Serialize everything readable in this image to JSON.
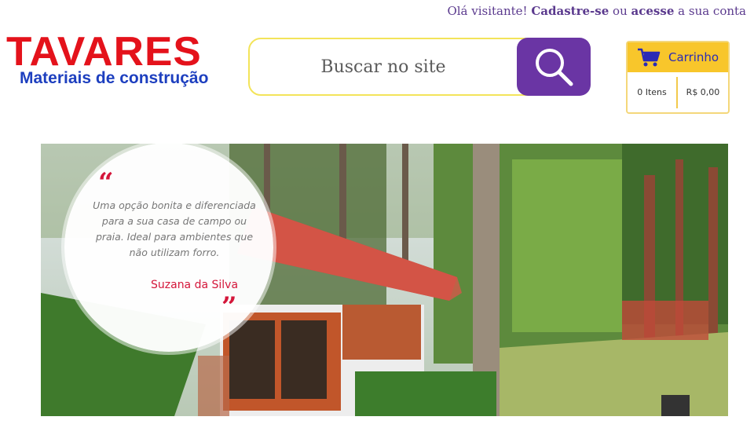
{
  "header": {
    "greeting": "Olá visitante!",
    "signup_link": "Cadastre-se",
    "or_text": "ou",
    "login_link": "acesse",
    "account_text": "a sua conta"
  },
  "logo": {
    "title": "TAVARES",
    "subtitle": "Materiais de construção"
  },
  "search": {
    "placeholder": "Buscar no site",
    "button_icon": "search-icon"
  },
  "cart": {
    "title": "Carrinho",
    "icon": "cart-icon",
    "items": "0 Itens",
    "total": "R$ 0,00"
  },
  "banner": {
    "quote_open": "“",
    "quote": "Uma opção bonita e diferenciada para a sua casa de campo ou praia. Ideal para ambientes que não utilizam forro.",
    "author": "Suzana da Silva",
    "quote_close": "”"
  },
  "colors": {
    "brand_red": "#e4121b",
    "brand_blue": "#1d3fbf",
    "accent_purple": "#6a35a4",
    "cart_yellow": "#f8c62b",
    "quote_red": "#d4163a"
  }
}
